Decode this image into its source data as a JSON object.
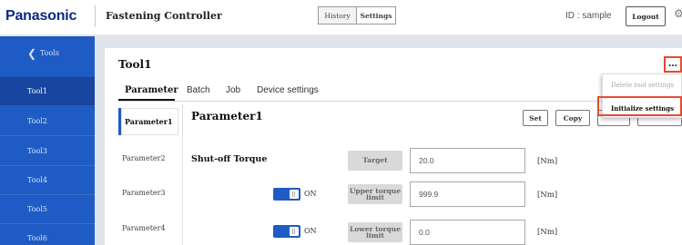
{
  "brand": {
    "logo": "Panasonic",
    "app_title": "Fastening Controller",
    "accent": "#1f5bc4",
    "highlight": "#e74a2e"
  },
  "header": {
    "history_label": "History",
    "settings_label": "Settings",
    "user_id": "ID : sample",
    "logout_label": "Logout",
    "settings_icon": "gear-icon"
  },
  "sidebar": {
    "back_label": "Tools",
    "items": [
      {
        "label": "Tool1",
        "active": true
      },
      {
        "label": "Tool2"
      },
      {
        "label": "Tool3"
      },
      {
        "label": "Tool4"
      },
      {
        "label": "Tool5"
      },
      {
        "label": "Tool6"
      }
    ]
  },
  "main": {
    "tool_title": "Tool1",
    "tabs": [
      {
        "label": "Parameter",
        "active": true
      },
      {
        "label": "Batch"
      },
      {
        "label": "Job"
      },
      {
        "label": "Device settings"
      }
    ],
    "parameters": [
      {
        "label": "Parameter1",
        "active": true
      },
      {
        "label": "Parameter2"
      },
      {
        "label": "Parameter3"
      },
      {
        "label": "Parameter4"
      }
    ],
    "param_heading": "Parameter1",
    "set_label": "Set",
    "copy_label": "Copy",
    "section_label": "Shut-off Torque",
    "fields": [
      {
        "label": "Target",
        "value": "20.0",
        "unit": "[Nm]"
      },
      {
        "label": "Upper torque limit",
        "value": "999.9",
        "unit": "[Nm]",
        "toggle": "ON"
      },
      {
        "label": "Lower torque limit",
        "value": "0.0",
        "unit": "[Nm]",
        "toggle": "ON"
      }
    ]
  },
  "menu": {
    "more_label": "…",
    "items": [
      {
        "label": "Delete tool settings",
        "disabled": true
      },
      {
        "label": "Initialize settings",
        "highlighted": true
      }
    ]
  }
}
